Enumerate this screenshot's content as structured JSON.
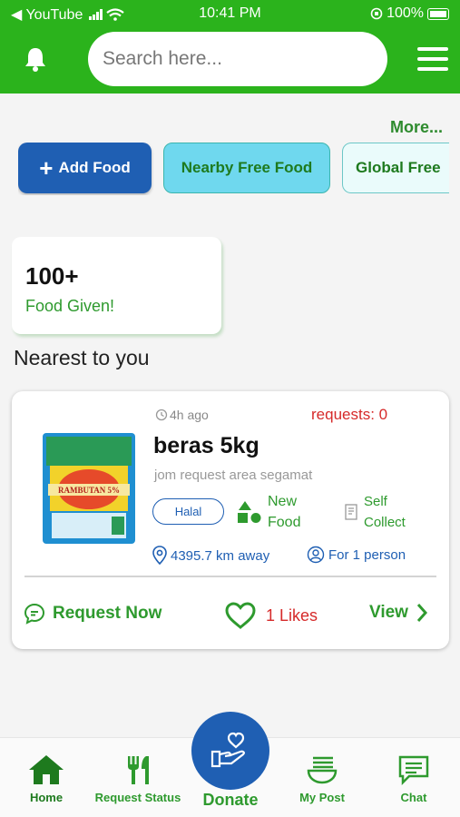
{
  "status_bar": {
    "back_app": "◀ YouTube",
    "time": "10:41 PM",
    "battery": "100%"
  },
  "header": {
    "search_placeholder": "Search here...",
    "icons": [
      "bell-icon",
      "menu-icon"
    ]
  },
  "more_link": "More...",
  "actions": {
    "add_food": "Add Food",
    "nearby_free_food": "Nearby Free Food",
    "global_free": "Global Free"
  },
  "stats": {
    "count": "100+",
    "label": "Food Given!"
  },
  "section_title": "Nearest to you",
  "food_card": {
    "time_ago": "4h ago",
    "requests": "requests: 0",
    "title": "beras 5kg",
    "description": "jom request area segamat",
    "tag_halal": "Halal",
    "tag_new": [
      "New",
      "Food"
    ],
    "tag_self": [
      "Self",
      "Collect"
    ],
    "distance": "4395.7 km away",
    "portion": "For 1 person",
    "request_label": "Request Now",
    "likes_label": "1 Likes",
    "view_label": "View",
    "image_text": "RAMBUTAN 5%"
  },
  "bottom_nav": {
    "home": "Home",
    "request_status": "Request Status",
    "donate": "Donate",
    "my_post": "My Post",
    "chat": "Chat"
  },
  "colors": {
    "brand_green": "#2bb31c",
    "accent_blue": "#1f5fb3",
    "alert_red": "#d62a2a"
  }
}
